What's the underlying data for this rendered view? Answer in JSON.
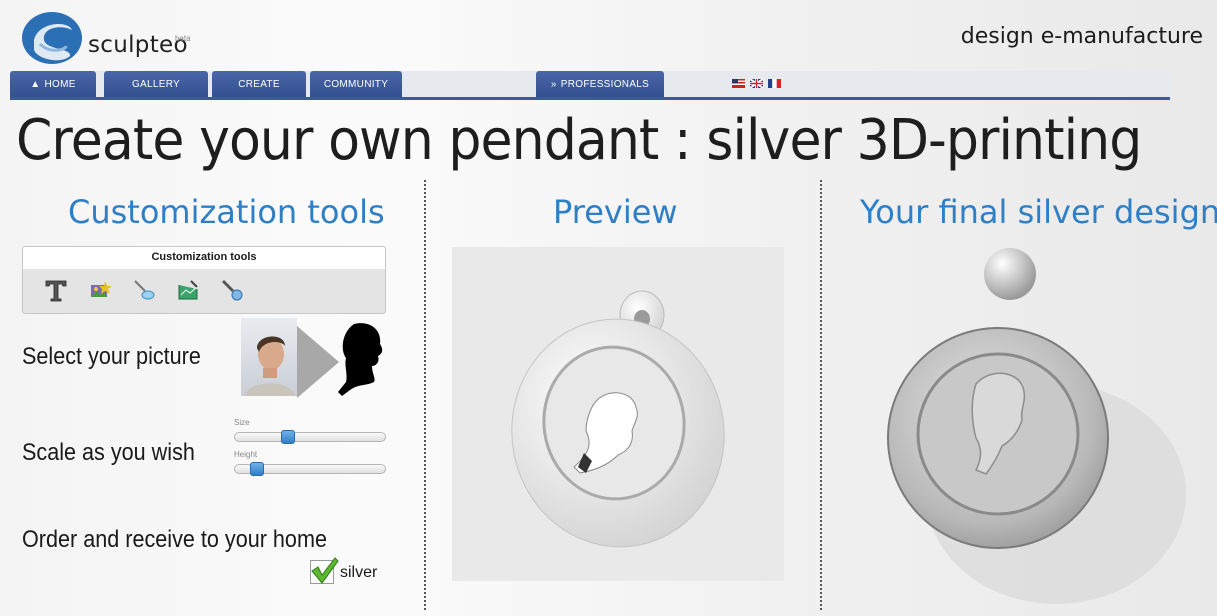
{
  "brand": {
    "name": "sculpteo",
    "beta": "beta",
    "tagline": "design e-manufacture",
    "accent": "#2f7fc6",
    "nav_color": "#3b5a9a"
  },
  "nav": {
    "tabs": [
      {
        "label": "HOME",
        "icon": "home-icon"
      },
      {
        "label": "GALLERY"
      },
      {
        "label": "CREATE"
      },
      {
        "label": "COMMUNITY"
      },
      {
        "label": "PROFESSIONALS",
        "icon": "double-chevron-icon"
      }
    ],
    "flags": [
      "us-flag-icon",
      "uk-flag-icon",
      "france-flag-icon"
    ]
  },
  "title": "Create your own pendant : silver 3D-printing",
  "columns": {
    "left": "Customization tools",
    "middle": "Preview",
    "right": "Your final silver design"
  },
  "tools_panel": {
    "header": "Customization tools",
    "icons": [
      "text-tool-icon",
      "image-tool-icon",
      "sculpt-tool-icon",
      "frame-tool-icon",
      "color-tool-icon"
    ]
  },
  "steps": {
    "select": "Select your picture",
    "scale": "Scale as you wish",
    "order": "Order and receive to your home"
  },
  "sliders": [
    {
      "label": "Size",
      "value": 0.35
    },
    {
      "label": "Height",
      "value": 0.1
    }
  ],
  "material": {
    "label": "silver",
    "checked": true
  }
}
